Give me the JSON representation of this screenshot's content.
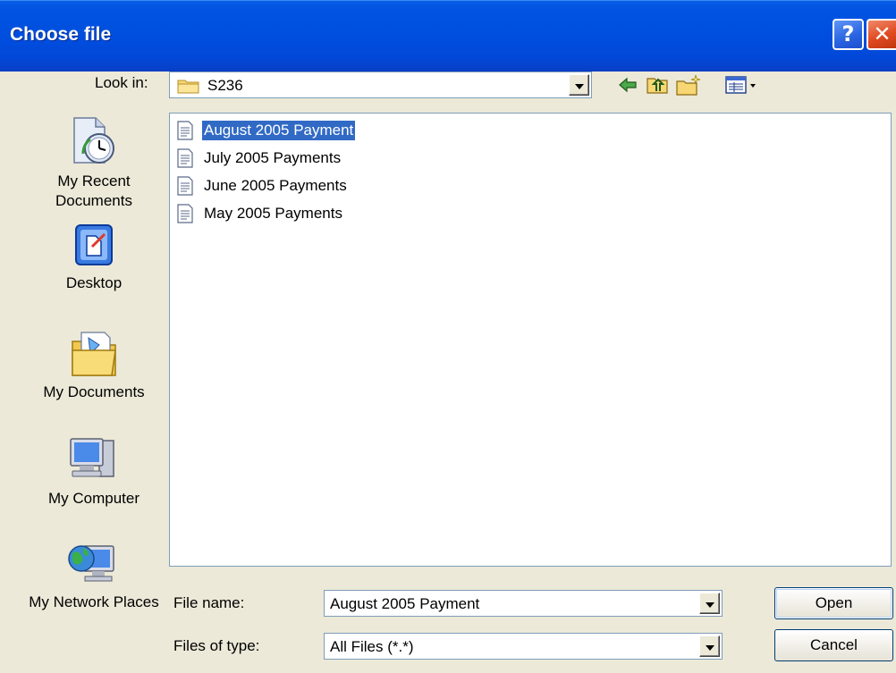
{
  "window": {
    "title": "Choose file"
  },
  "look_in": {
    "label": "Look in:",
    "value": "S236"
  },
  "places": [
    {
      "label": "My Recent Documents",
      "icon": "recent-documents-icon"
    },
    {
      "label": "Desktop",
      "icon": "desktop-icon"
    },
    {
      "label": "My Documents",
      "icon": "my-documents-icon"
    },
    {
      "label": "My Computer",
      "icon": "my-computer-icon"
    },
    {
      "label": "My Network Places",
      "icon": "network-places-icon"
    }
  ],
  "files": [
    {
      "name": "August 2005 Payment",
      "selected": true
    },
    {
      "name": "July 2005 Payments",
      "selected": false
    },
    {
      "name": "June 2005 Payments",
      "selected": false
    },
    {
      "name": "May 2005 Payments",
      "selected": false
    }
  ],
  "file_name": {
    "label": "File name:",
    "value": "August 2005 Payment"
  },
  "file_type": {
    "label": "Files of type:",
    "value": "All Files (*.*)"
  },
  "buttons": {
    "open": "Open",
    "cancel": "Cancel"
  },
  "colors": {
    "titlebar": "#0050e0",
    "selection": "#316ac5",
    "face": "#ece9d8"
  }
}
